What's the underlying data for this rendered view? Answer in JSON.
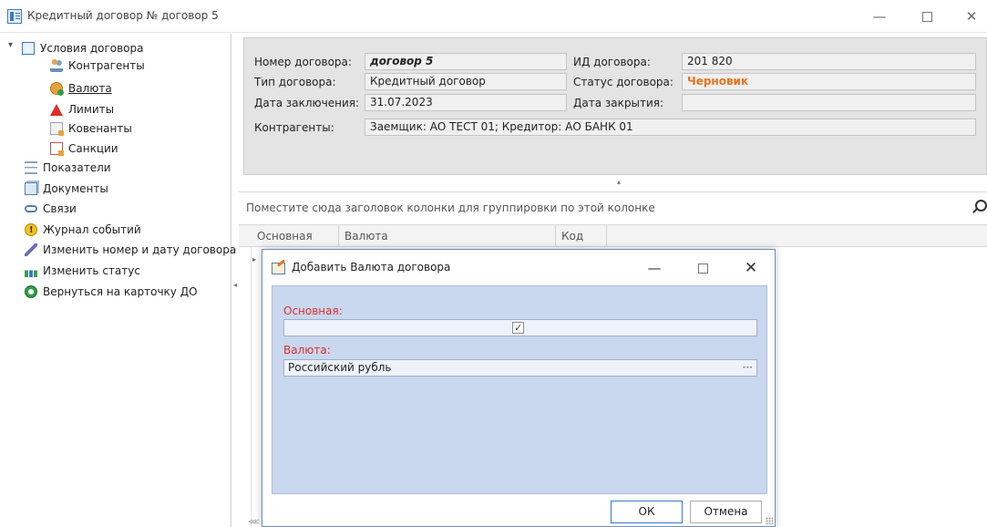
{
  "window": {
    "title": "Кредитный договор № договор 5",
    "minimize": "—",
    "close": "✕"
  },
  "nav": {
    "items": [
      {
        "label": "Условия договора",
        "icon": "tree-icon"
      },
      {
        "label": "Контрагенты",
        "icon": "people-icon"
      },
      {
        "label": "Валюта",
        "icon": "coins-icon",
        "active": true
      },
      {
        "label": "Лимиты",
        "icon": "warning-icon"
      },
      {
        "label": "Ковенанты",
        "icon": "document-icon"
      },
      {
        "label": "Санкции",
        "icon": "sanctions-icon"
      },
      {
        "label": "Показатели",
        "icon": "list-icon"
      },
      {
        "label": "Документы",
        "icon": "documents-icon"
      },
      {
        "label": "Связи",
        "icon": "link-icon"
      },
      {
        "label": "Журнал событий",
        "icon": "event-log-icon"
      },
      {
        "label": "Изменить номер и дату  договора",
        "icon": "edit-pen-icon"
      },
      {
        "label": "Изменить статус",
        "icon": "status-icon"
      },
      {
        "label": "Вернуться на карточку ДО",
        "icon": "back-icon"
      }
    ]
  },
  "contract": {
    "number_label": "Номер договора:",
    "number_value": "договор 5",
    "id_label": "ИД договора:",
    "id_value": "201 820",
    "type_label": "Тип договора:",
    "type_value": "Кредитный договор",
    "status_label": "Статус договора:",
    "status_value": "Черновик",
    "date_label": "Дата заключения:",
    "date_value": "31.07.2023",
    "close_date_label": "Дата закрытия:",
    "close_date_value": "",
    "parties_label": "Контрагенты:",
    "parties_value": "Заемщик: АО ТЕСТ 01; Кредитор: АО БАНК 01"
  },
  "grid": {
    "group_hint": "Поместите сюда заголовок колонки для группировки по этой колонке",
    "columns": [
      "Основная",
      "Валюта",
      "Код"
    ]
  },
  "dialog": {
    "title": "Добавить Валюта договора",
    "minimize": "—",
    "close": "✕",
    "main_label": "Основная:",
    "main_checked": true,
    "main_check_glyph": "✓",
    "currency_label": "Валюта:",
    "currency_value": "Российский рубль",
    "ellipsis": "···",
    "ok_label": "ОК",
    "cancel_label": "Отмена"
  },
  "colors": {
    "status_draft": "#e8731e",
    "required_label": "#d9302a",
    "dialog_body": "#c9d7ef",
    "form_panel": "#e4e4e4"
  }
}
